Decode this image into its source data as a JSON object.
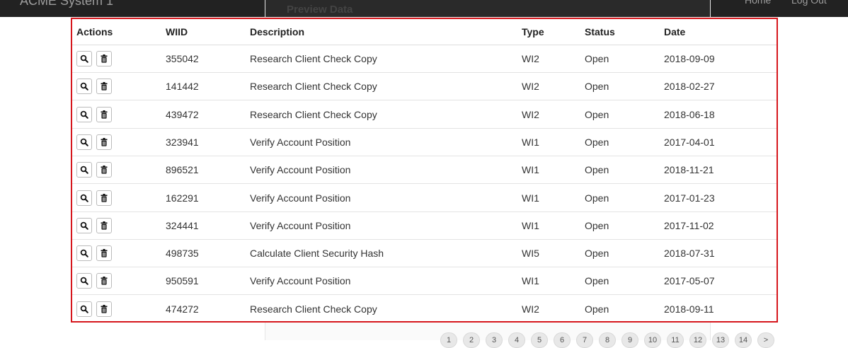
{
  "navbar": {
    "brand": "ACME System 1",
    "home": "Home",
    "logout": "Log Out"
  },
  "background_modal": {
    "title": "Preview Data",
    "header": [
      "Actions",
      "WIID",
      "Description",
      "Type",
      "Status",
      "Date"
    ],
    "rows": [
      [
        "",
        "355042",
        "Research Client C",
        "WI2",
        "Open",
        "2018-09-09"
      ],
      [
        "",
        "141442",
        "Research Client C",
        "WI2",
        "Open",
        "2018-02-27"
      ],
      [
        "",
        "439472",
        "Research Client C",
        "WI2",
        "Open",
        "2018-06-18"
      ],
      [
        "",
        "323941",
        "Verify Account Po",
        "WI1",
        "Open",
        "2017-04-01"
      ],
      [
        "",
        "896521",
        "Verify Account Po",
        "WI1",
        "Open",
        "2018-11-21"
      ],
      [
        "",
        "162291",
        "Verify Account Po",
        "WI1",
        "Open",
        "2017-01-23"
      ],
      [
        "",
        "324441",
        "Verify Account Po",
        "WI1",
        "Open",
        "2017-11-02"
      ],
      [
        "",
        "498735",
        "Calculate Client S",
        "WI5",
        "Open",
        "2018-07-31"
      ],
      [
        "",
        "950591",
        "Verify Account Po",
        "WI1",
        "Open",
        "2017-05-07"
      ],
      [
        "",
        "474272",
        "Research Client C",
        "WI2",
        "Open",
        "2018-09-11"
      ]
    ]
  },
  "table": {
    "columns": {
      "actions": "Actions",
      "wiid": "WIID",
      "description": "Description",
      "type": "Type",
      "status": "Status",
      "date": "Date"
    },
    "rows": [
      {
        "wiid": "355042",
        "description": "Research Client Check Copy",
        "type": "WI2",
        "status": "Open",
        "date": "2018-09-09"
      },
      {
        "wiid": "141442",
        "description": "Research Client Check Copy",
        "type": "WI2",
        "status": "Open",
        "date": "2018-02-27"
      },
      {
        "wiid": "439472",
        "description": "Research Client Check Copy",
        "type": "WI2",
        "status": "Open",
        "date": "2018-06-18"
      },
      {
        "wiid": "323941",
        "description": "Verify Account Position",
        "type": "WI1",
        "status": "Open",
        "date": "2017-04-01"
      },
      {
        "wiid": "896521",
        "description": "Verify Account Position",
        "type": "WI1",
        "status": "Open",
        "date": "2018-11-21"
      },
      {
        "wiid": "162291",
        "description": "Verify Account Position",
        "type": "WI1",
        "status": "Open",
        "date": "2017-01-23"
      },
      {
        "wiid": "324441",
        "description": "Verify Account Position",
        "type": "WI1",
        "status": "Open",
        "date": "2017-11-02"
      },
      {
        "wiid": "498735",
        "description": "Calculate Client Security Hash",
        "type": "WI5",
        "status": "Open",
        "date": "2018-07-31"
      },
      {
        "wiid": "950591",
        "description": "Verify Account Position",
        "type": "WI1",
        "status": "Open",
        "date": "2017-05-07"
      },
      {
        "wiid": "474272",
        "description": "Research Client Check Copy",
        "type": "WI2",
        "status": "Open",
        "date": "2018-09-11"
      }
    ],
    "row_actions": {
      "view_icon": "search-icon",
      "delete_icon": "trash-icon"
    },
    "highlight_color": "#d6161c"
  },
  "pagination": {
    "pages": [
      "1",
      "2",
      "3",
      "4",
      "5",
      "6",
      "7",
      "8",
      "9",
      "10",
      "11",
      "12",
      "13",
      "14",
      ">"
    ]
  }
}
